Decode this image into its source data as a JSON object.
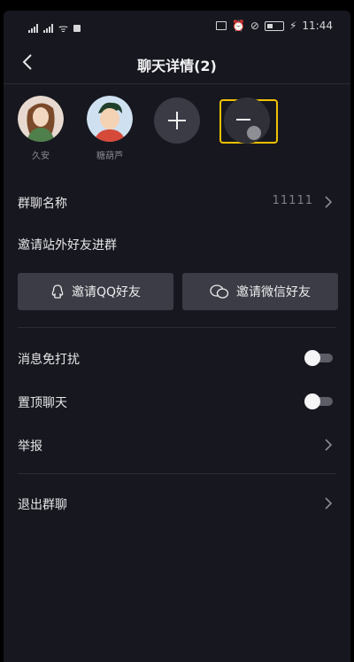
{
  "status_bar": {
    "carrier": "ᯤ",
    "time": "11:44"
  },
  "header": {
    "title": "聊天详情(2)"
  },
  "members": [
    {
      "name": "久安"
    },
    {
      "name": "糖葫芦"
    }
  ],
  "settings": {
    "group_name_label": "群聊名称",
    "group_name_value": "11111",
    "invite_title": "邀请站外好友进群",
    "invite_qq_label": "邀请QQ好友",
    "invite_wechat_label": "邀请微信好友",
    "mute_label": "消息免打扰",
    "mute_on": false,
    "pin_label": "置顶聊天",
    "pin_on": false,
    "report_label": "举报",
    "exit_label": "退出群聊"
  },
  "colors": {
    "background": "#17181f",
    "highlight": "#f2c200",
    "button": "#3b3c45"
  }
}
